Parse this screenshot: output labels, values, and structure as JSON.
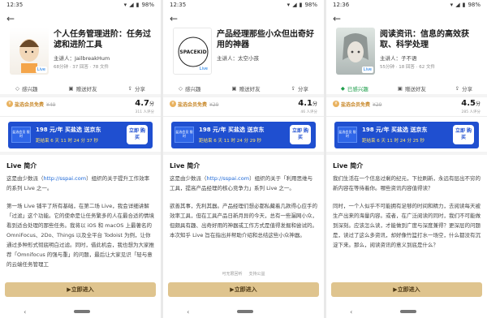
{
  "panels": [
    {
      "time": "12:35",
      "battery": "98%",
      "title": "个人任务管理进阶：任务过滤和进阶工具",
      "speaker": "主讲人：JailbreakHum",
      "meta": "68分钟 · 37 回答 · 78 文件",
      "actions": [
        "感兴趣",
        "赠送好友",
        "分享"
      ],
      "vip": "盐选会员免费",
      "orig_price": "¥49",
      "score": "4.7",
      "score_unit": "分",
      "rate_count": "311 人评分",
      "banner_tag": "盐选会员 限时",
      "banner_t1": "198 元/年 买盐选 送京东",
      "banner_t2": "距结束 6 天 11 时 24 分 37 秒",
      "banner_buy": "立即 购买",
      "intro_title": "Live 简介",
      "intro_p1_a": "这是由少数派（",
      "intro_link": "http://sspai.com",
      "intro_p1_b": "）组织的关于提升工作效率的系列 Live 之一。",
      "intro_p2": "第一场 Live 铺平了所有基础，在第二场 Live，我会详细讲解「过滤」这个功能。它的使命是让任务繁多的人在最合适的情境看到适合处理的那些任务。我将以 iOS 和 macOS 上最著名的 OmniFocus、2Do、Things 以及全平台 Todoist 为例，让你通过多种形式彻底明白过滤。同时，借此机会，我也想为大家推荐「Omnifocus 的强与重」的问题，最后让大家见识「轻与意的云端任务管理工",
      "cta": "立即进入",
      "flag1": "",
      "flag2": ""
    },
    {
      "time": "12:35",
      "battery": "98%",
      "title": "产品经理那些小众但出奇好用的神器",
      "speaker": "主讲人：太空小孩",
      "meta": "",
      "actions": [
        "感兴趣",
        "赠送好友",
        "分享"
      ],
      "vip": "盐选会员免费",
      "orig_price": "¥29",
      "score": "4.1",
      "score_unit": "分",
      "rate_count": "46 人评分",
      "banner_tag": "盐选会员 限时",
      "banner_t1": "198 元/年 买盐选 送京东",
      "banner_t2": "距结束 6 天 11 时 24 分 29 秒",
      "banner_buy": "立即 购买",
      "intro_title": "Live 简介",
      "intro_p1_a": "这是由少数派（",
      "intro_link": "http://sspai.com",
      "intro_p1_b": "）组织的关于「利用思维与工具，提高产品经理的核心竞争力」系列 Live 之一。",
      "intro_p2": "欲善其事，先利其器。产品经理们想必都私藏着几款得心应手的效率工具，但在工具产品日新月异的今天，总有一些漏网小众，但颇具有趣、出奇好用的神器或工作方式是值得发掘和尝试的。本次知乎 Live 旨在指出并帮助介绍和总结这些小众神器。",
      "cta": "立即进入",
      "flag1": "可无限回听",
      "flag2": "支持公益"
    },
    {
      "time": "12:36",
      "battery": "98%",
      "title": "阅读资讯：信息的高效获取、科学处理",
      "speaker": "主讲人：子不语",
      "meta": "55分钟 · 18 回答 · 62 文件",
      "actions": [
        "已感兴趣",
        "赠送好友",
        "分享"
      ],
      "vip": "盐选会员免费",
      "orig_price": "¥29",
      "score": "4.5",
      "score_unit": "分",
      "rate_count": "285 人评分",
      "banner_tag": "盐选会员 限时",
      "banner_t1": "198 元/年 买盐选 送京东",
      "banner_t2": "距结束 6 天 11 时 24 分 25 秒",
      "banner_buy": "立即 购买",
      "intro_title": "Live 简介",
      "intro_p1_a": "我们生活在一个信息过剩的纪元，下拉刷新，永远有层出不穷的新内容在等待着你。哪些资讯内容值得读？",
      "intro_link": "",
      "intro_p1_b": "",
      "intro_p2": "同时，一个人似乎不可能拥有足够的时间和精力，去阅读每天被生产出来的海量内容。或者，在广泛阅读的同时，我们不可能做到深刻。应该怎么读，才能做到广度与深度兼得？更深层的问题是，读过了这么多资讯，却好像竹篮打水一场空，什么都没有沉淀下来。那么，阅读资讯的意义到底是什么？",
      "cta": "立即进入",
      "flag1": "",
      "flag2": ""
    }
  ]
}
